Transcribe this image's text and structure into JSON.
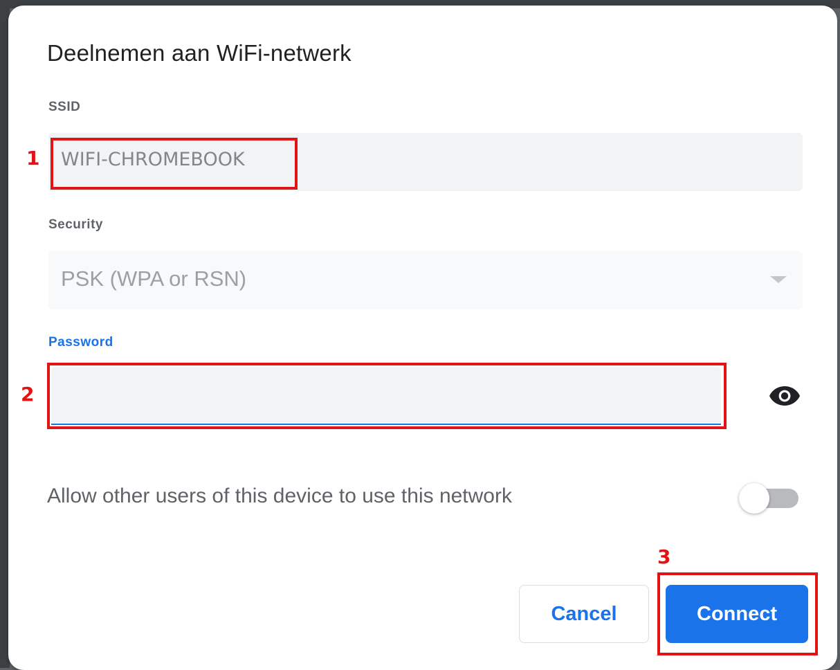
{
  "dialog": {
    "title": "Deelnemen aan WiFi-netwerk",
    "ssid": {
      "label": "SSID",
      "value": "WIFI-CHROMEBOOK"
    },
    "security": {
      "label": "Security",
      "value": "PSK (WPA or RSN)"
    },
    "password": {
      "label": "Password",
      "value": ""
    },
    "allow_others": {
      "label": "Allow other users of this device to use this network",
      "enabled": false
    },
    "buttons": {
      "cancel": "Cancel",
      "connect": "Connect"
    }
  },
  "annotations": {
    "step1": "1",
    "step2": "2",
    "step3": "3"
  },
  "colors": {
    "accent": "#1a73e8",
    "annotation": "#e01414"
  },
  "icons": {
    "password_visibility": "eye-icon",
    "security_dropdown": "dropdown-arrow-icon"
  }
}
